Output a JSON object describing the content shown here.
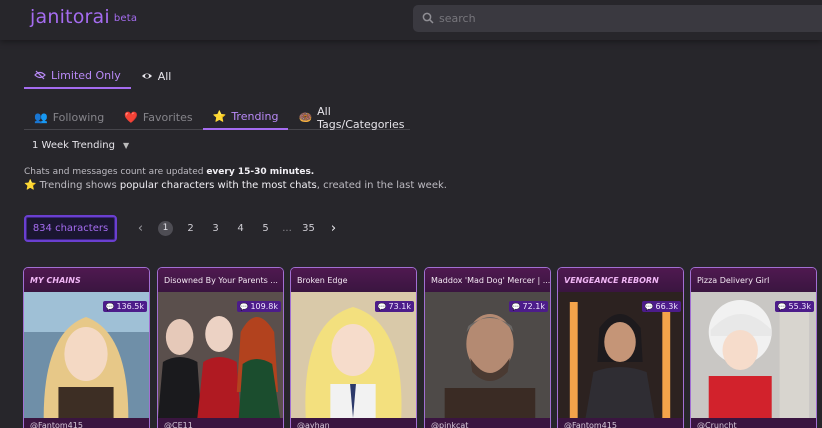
{
  "header": {
    "logo": "janitorai",
    "beta": "beta",
    "search_placeholder": "search"
  },
  "filter": {
    "limited_label": "Limited Only",
    "all_label": "All"
  },
  "tabs": [
    {
      "emoji": "👥",
      "label": "Following"
    },
    {
      "emoji": "❤️",
      "label": "Favorites"
    },
    {
      "emoji": "⭐",
      "label": "Trending"
    },
    {
      "emoji": "🍩",
      "label": "All Tags/Categories"
    }
  ],
  "trend_select": "1 Week Trending",
  "info": {
    "line1_a": "Chats and messages count are updated ",
    "line1_b": "every 15-30 minutes.",
    "line2_emoji": "⭐",
    "line2_a": " Trending shows ",
    "line2_b": "popular characters with the most chats",
    "line2_c": ", created in the last week."
  },
  "count": "834 characters",
  "pagination": {
    "pages": [
      "1",
      "2",
      "3",
      "4",
      "5",
      "...",
      "35"
    ],
    "current": "1"
  },
  "cards": [
    {
      "title": "MY CHAINS",
      "views": "136.5k",
      "author": "@Fantom415"
    },
    {
      "title": "Disowned By Your Parents ...",
      "views": "109.8k",
      "author": "@CE11"
    },
    {
      "title": "Broken Edge",
      "views": "73.1k",
      "author": "@ayhan"
    },
    {
      "title": "Maddox 'Mad Dog' Mercer | ...",
      "views": "72.1k",
      "author": "@pinkcat"
    },
    {
      "title": "VENGEANCE REBORN",
      "views": "66.3k",
      "author": "@Fantom415"
    },
    {
      "title": "Pizza Delivery Girl",
      "views": "55.3k",
      "author": "@Cruncht"
    }
  ],
  "colors": {
    "accent": "#a56cf0",
    "card_header": "#4f1950",
    "badge": "#4c1c8a"
  }
}
